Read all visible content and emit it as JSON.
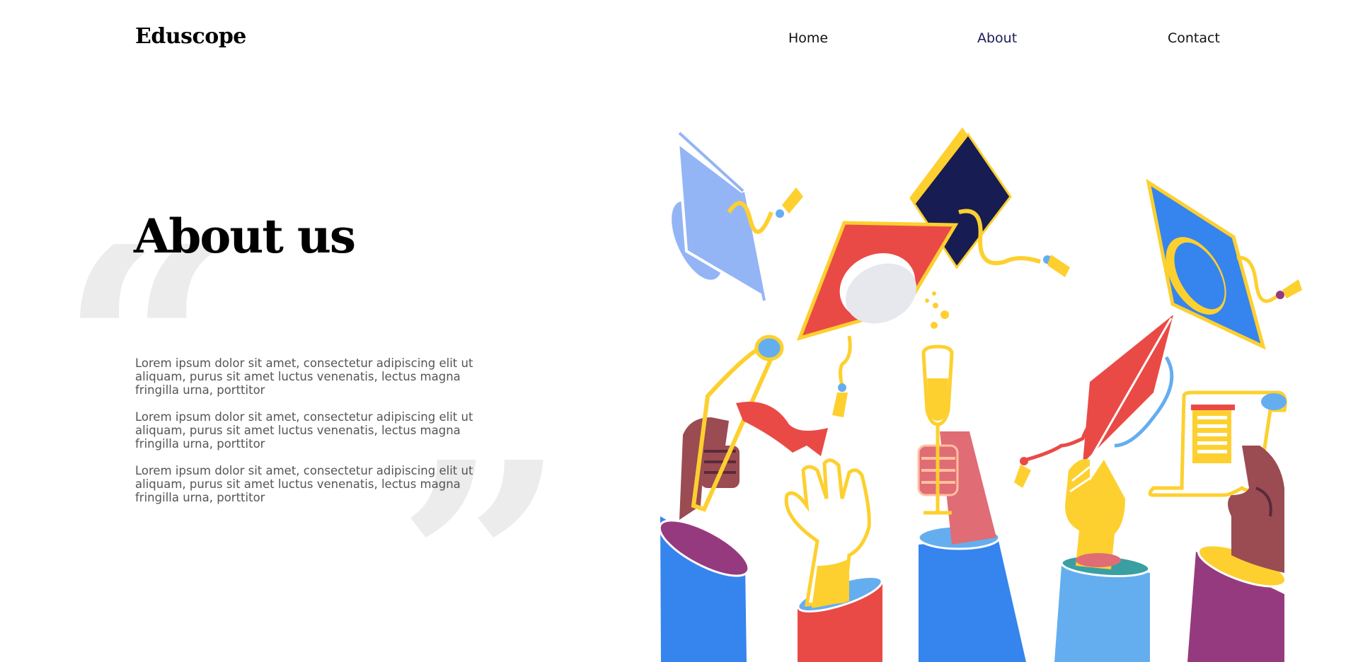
{
  "header": {
    "logo": "Eduscope",
    "nav": [
      {
        "label": "Home"
      },
      {
        "label": "About"
      },
      {
        "label": "Contact"
      }
    ]
  },
  "main": {
    "title": "About us",
    "quote_open": "“",
    "quote_close": "”",
    "paragraphs": [
      "Lorem ipsum dolor sit amet, consectetur adipiscing elit ut aliquam, purus sit amet luctus venenatis, lectus magna fringilla urna, porttitor",
      "Lorem ipsum dolor sit amet, consectetur adipiscing elit ut aliquam, purus sit amet luctus venenatis, lectus magna fringilla urna, porttitor",
      "Lorem ipsum dolor sit amet, consectetur adipiscing elit ut aliquam, purus sit amet luctus venenatis, lectus magna fringilla urna, porttitor"
    ]
  },
  "colors": {
    "navy": "#171c52",
    "yellow": "#fdd02f",
    "red": "#ea4a45",
    "blue": "#3684ee",
    "light_blue": "#93b5f6",
    "sky_blue": "#64aef0",
    "purple": "#963a7f",
    "brown": "#9a4c52",
    "pink": "#e06c75"
  },
  "illustration": {
    "icon": "graduation-celebration-illustration"
  }
}
